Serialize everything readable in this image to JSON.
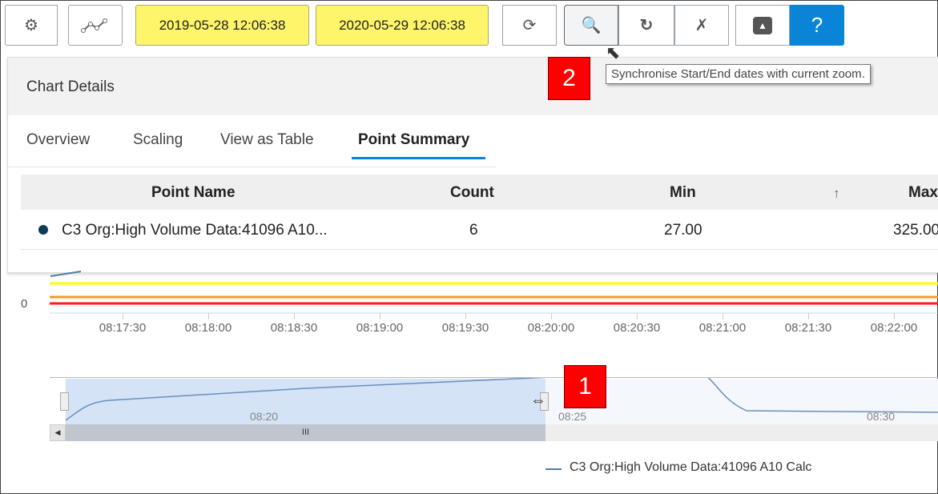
{
  "toolbar": {
    "start_date": "2019-05-28 12:06:38",
    "end_date": "2020-05-29 12:06:38",
    "help_label": "?"
  },
  "tooltip": "Synchronise Start/End dates with current zoom.",
  "annotations": {
    "one": "1",
    "two": "2"
  },
  "panel": {
    "title": "Chart Details",
    "tabs": [
      "Overview",
      "Scaling",
      "View as Table",
      "Point Summary"
    ],
    "active_tab": "Point Summary",
    "columns": {
      "name": "Point Name",
      "count": "Count",
      "min": "Min",
      "max": "Max"
    },
    "rows": [
      {
        "name": "C3 Org:High Volume Data:41096 A10...",
        "count": "6",
        "min": "27.00",
        "max": "325.00"
      }
    ],
    "series_color": "#0d3d56"
  },
  "chart": {
    "y_label": "0",
    "x_ticks": [
      "08:17:30",
      "08:18:00",
      "08:18:30",
      "08:19:00",
      "08:19:30",
      "08:20:00",
      "08:20:30",
      "08:21:00",
      "08:21:30",
      "08:22:00"
    ],
    "navigator_ticks": [
      "08:20",
      "08:25",
      "08:30"
    ],
    "legend": "C3 Org:High Volume Data:41096 A10 Calc",
    "scrollbar_grip": "III",
    "colors": {
      "yellow": "#ffff00",
      "orange": "#ff9a1a",
      "red": "#ff1a1a",
      "series": "#6b8fbf",
      "accent": "#0a84d6"
    }
  }
}
